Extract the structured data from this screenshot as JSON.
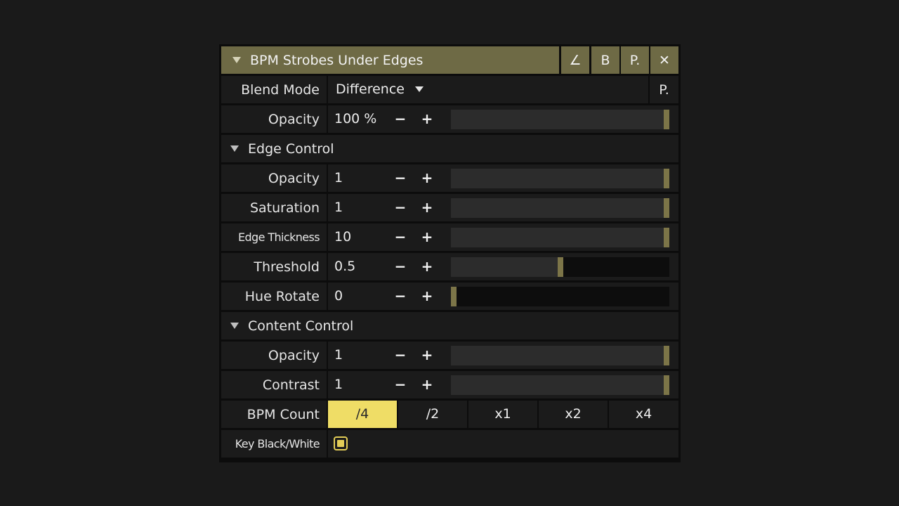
{
  "header": {
    "title": "BPM Strobes Under Edges",
    "buttons": [
      {
        "name": "edit-button",
        "label": "∠"
      },
      {
        "name": "bypass-button",
        "label": "B"
      },
      {
        "name": "preset-button",
        "label": "P."
      },
      {
        "name": "close-button",
        "label": "✕"
      }
    ]
  },
  "blend_mode": {
    "label": "Blend Mode",
    "value": "Difference",
    "preset_label": "P."
  },
  "opacity": {
    "label": "Opacity",
    "value": "100 %",
    "level": 1.0
  },
  "edge_control": {
    "title": "Edge Control",
    "params": [
      {
        "label": "Opacity",
        "value": "1",
        "level": 1.0
      },
      {
        "label": "Saturation",
        "value": "1",
        "level": 1.0
      },
      {
        "label": "Edge Thickness",
        "value": "10",
        "level": 1.0
      },
      {
        "label": "Threshold",
        "value": "0.5",
        "level": 0.5
      },
      {
        "label": "Hue Rotate",
        "value": "0",
        "level": 0.0
      }
    ]
  },
  "content_control": {
    "title": "Content Control",
    "params": [
      {
        "label": "Opacity",
        "value": "1",
        "level": 1.0
      },
      {
        "label": "Contrast",
        "value": "1",
        "level": 1.0
      }
    ]
  },
  "bpm_count": {
    "label": "BPM Count",
    "options": [
      "/4",
      "/2",
      "x1",
      "x2",
      "x4"
    ],
    "selected": "/4"
  },
  "key_bw": {
    "label": "Key Black/White",
    "checked": true
  },
  "controls": {
    "minus": "−",
    "plus": "+"
  },
  "colors": {
    "header_bg": "#6e6a45",
    "accent_yellow": "#efdd66",
    "slider_handle": "#7c7548",
    "panel_bg": "#1b1b1b"
  }
}
